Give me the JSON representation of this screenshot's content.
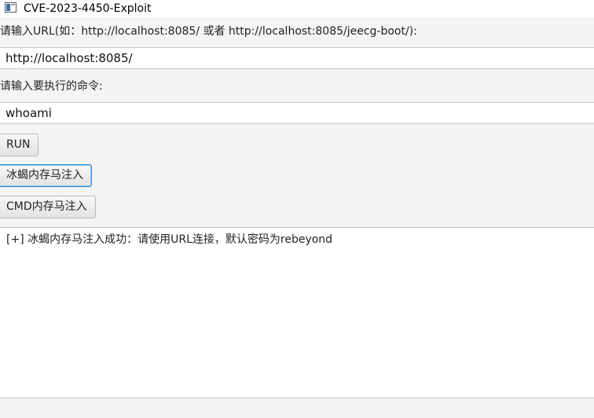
{
  "window": {
    "title": "CVE-2023-4450-Exploit",
    "app_icon": "window-app-icon"
  },
  "url_section": {
    "label": "请输入URL(如：http://localhost:8085/ 或者 http://localhost:8085/jeecg-boot/):",
    "value": "http://localhost:8085/"
  },
  "command_section": {
    "label": "请输入要执行的命令:",
    "value": "whoami"
  },
  "buttons": {
    "run": "RUN",
    "behinder_inject": "冰蝎内存马注入",
    "cmd_inject": "CMD内存马注入"
  },
  "output": {
    "lines": [
      "[+] 冰蝎内存马注入成功：请使用URL连接，默认密码为rebeyond"
    ]
  }
}
